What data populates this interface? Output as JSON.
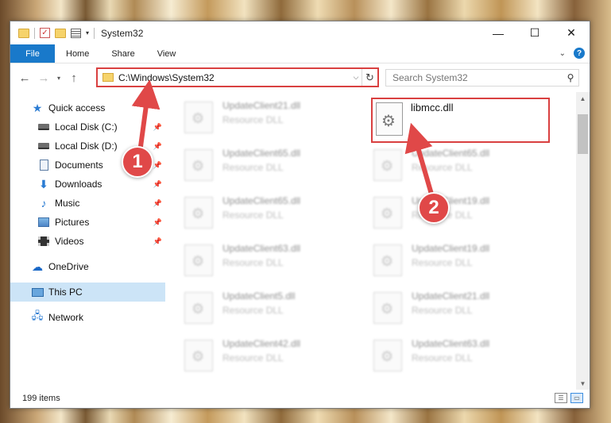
{
  "window": {
    "title": "System32",
    "controls": {
      "minimize": "—",
      "maximize": "☐",
      "close": "✕"
    }
  },
  "ribbon": {
    "tabs": [
      {
        "label": "File"
      },
      {
        "label": "Home"
      },
      {
        "label": "Share"
      },
      {
        "label": "View"
      }
    ],
    "help": "?"
  },
  "address": {
    "path": "C:\\Windows\\System32",
    "search_placeholder": "Search System32"
  },
  "sidebar": {
    "items": [
      {
        "label": "Quick access",
        "icon": "star-icon"
      },
      {
        "label": "Local Disk (C:)",
        "icon": "disk-icon",
        "pinned": true
      },
      {
        "label": "Local Disk (D:)",
        "icon": "disk-icon",
        "pinned": true
      },
      {
        "label": "Documents",
        "icon": "document-icon",
        "pinned": true
      },
      {
        "label": "Downloads",
        "icon": "download-icon",
        "pinned": true
      },
      {
        "label": "Music",
        "icon": "music-icon",
        "pinned": true
      },
      {
        "label": "Pictures",
        "icon": "picture-icon",
        "pinned": true
      },
      {
        "label": "Videos",
        "icon": "video-icon",
        "pinned": true
      },
      {
        "label": "OneDrive",
        "icon": "cloud-icon"
      },
      {
        "label": "This PC",
        "icon": "computer-icon",
        "selected": true
      },
      {
        "label": "Network",
        "icon": "network-icon"
      }
    ]
  },
  "files": {
    "target": {
      "name": "libmcc.dll"
    },
    "left_column": [
      {
        "name": "UpdateClient21.dll",
        "type": "Resource DLL"
      },
      {
        "name": "UpdateClient65.dll",
        "type": "Resource DLL"
      },
      {
        "name": "UpdateClient65.dll",
        "type": "Resource DLL"
      },
      {
        "name": "UpdateClient63.dll",
        "type": "Resource DLL"
      },
      {
        "name": "UpdateClient5.dll",
        "type": "Resource DLL"
      },
      {
        "name": "UpdateClient42.dll",
        "type": "Resource DLL"
      }
    ],
    "right_column": [
      {
        "name": "UpdateClient65.dll",
        "type": "Resource DLL"
      },
      {
        "name": "UpdateClient19.dll",
        "type": "Resource DLL"
      },
      {
        "name": "UpdateClient19.dll",
        "type": "Resource DLL"
      },
      {
        "name": "UpdateClient21.dll",
        "type": "Resource DLL"
      },
      {
        "name": "UpdateClient63.dll",
        "type": "Resource DLL"
      }
    ]
  },
  "status": {
    "item_count": "199 items"
  },
  "callouts": {
    "first": "1",
    "second": "2",
    "color": "#e04848"
  }
}
